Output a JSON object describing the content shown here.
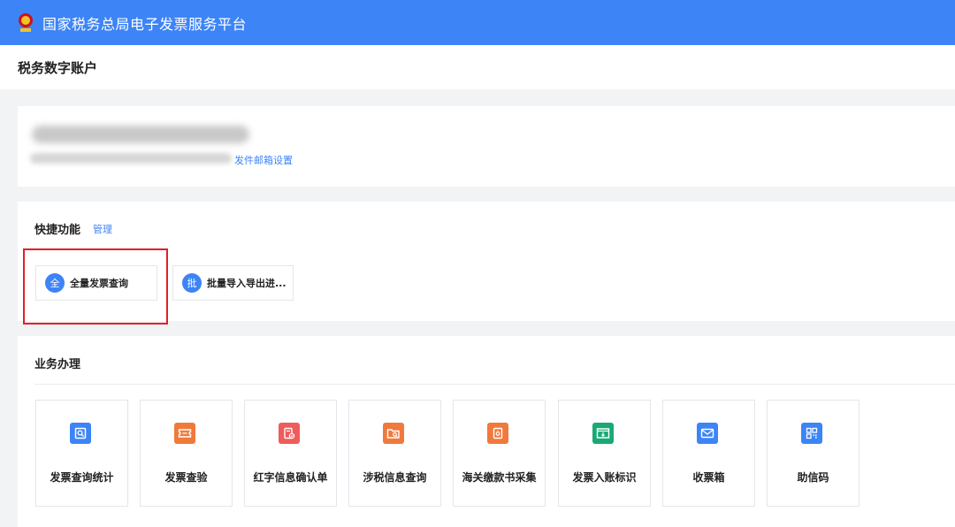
{
  "app": {
    "title": "国家税务总局电子发票服务平台"
  },
  "page": {
    "title": "税务数字账户"
  },
  "account": {
    "email_link": "发件邮箱设置"
  },
  "quick": {
    "title": "快捷功能",
    "manage": "管理",
    "items": [
      {
        "badge": "全",
        "label": "全量发票查询"
      },
      {
        "badge": "批",
        "label": "批量导入导出进..."
      }
    ]
  },
  "business": {
    "title": "业务办理",
    "tiles": [
      {
        "label": "发票查询统计",
        "icon": "search-document-icon",
        "color": "#3d84f6"
      },
      {
        "label": "发票查验",
        "icon": "ticket-icon",
        "color": "#f07a3c"
      },
      {
        "label": "红字信息确认单",
        "icon": "document-check-icon",
        "color": "#ee5c5c"
      },
      {
        "label": "涉税信息查询",
        "icon": "folder-search-icon",
        "color": "#f07a3c"
      },
      {
        "label": "海关缴款书采集",
        "icon": "customs-icon",
        "color": "#f07a3c"
      },
      {
        "label": "发票入账标识",
        "icon": "receipt-download-icon",
        "color": "#19a975"
      },
      {
        "label": "收票箱",
        "icon": "mail-icon",
        "color": "#3d84f6"
      },
      {
        "label": "助信码",
        "icon": "qr-code-icon",
        "color": "#3d84f6"
      }
    ]
  }
}
